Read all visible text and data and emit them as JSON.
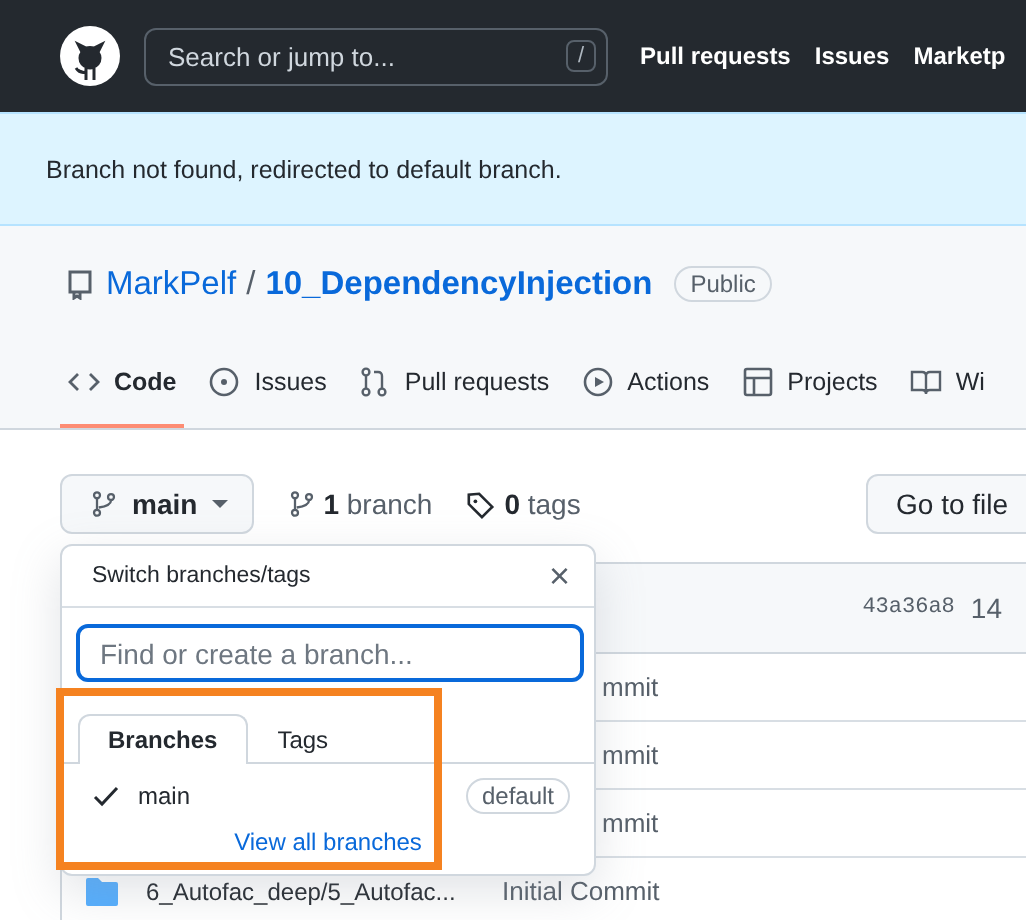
{
  "header": {
    "search": {
      "placeholder": "Search or jump to...",
      "shortcut": "/"
    },
    "nav": [
      "Pull requests",
      "Issues",
      "Marketp"
    ]
  },
  "flash": "Branch not found, redirected to default branch.",
  "repo": {
    "owner": "MarkPelf",
    "separator": "/",
    "name": "10_DependencyInjection",
    "visibility": "Public"
  },
  "tabs": [
    {
      "label": "Code",
      "selected": true
    },
    {
      "label": "Issues",
      "selected": false
    },
    {
      "label": "Pull requests",
      "selected": false
    },
    {
      "label": "Actions",
      "selected": false
    },
    {
      "label": "Projects",
      "selected": false
    },
    {
      "label": "Wi",
      "selected": false
    }
  ],
  "branch_bar": {
    "branch": "main",
    "branches": "**1** branch",
    "tags": "**0** tags",
    "go_to_file": "Go to file"
  },
  "files": {
    "commit": "43a36a8",
    "age": "14",
    "rows": [
      {
        "message": "mmit"
      },
      {
        "message": "mmit"
      },
      {
        "message": "mmit"
      },
      {
        "name": "6_Autofac_deep/5_Autofac...",
        "message": "Initial Commit"
      }
    ]
  },
  "dropdown": {
    "title": "Switch branches/tags",
    "close": "×",
    "placeholder": "Find or create a branch...",
    "tabs": [
      {
        "label": "Branches",
        "selected": true
      },
      {
        "label": "Tags",
        "selected": false
      }
    ],
    "items": [
      {
        "name": "main",
        "checked": true,
        "badge": "default"
      }
    ],
    "link": "View all branches"
  }
}
